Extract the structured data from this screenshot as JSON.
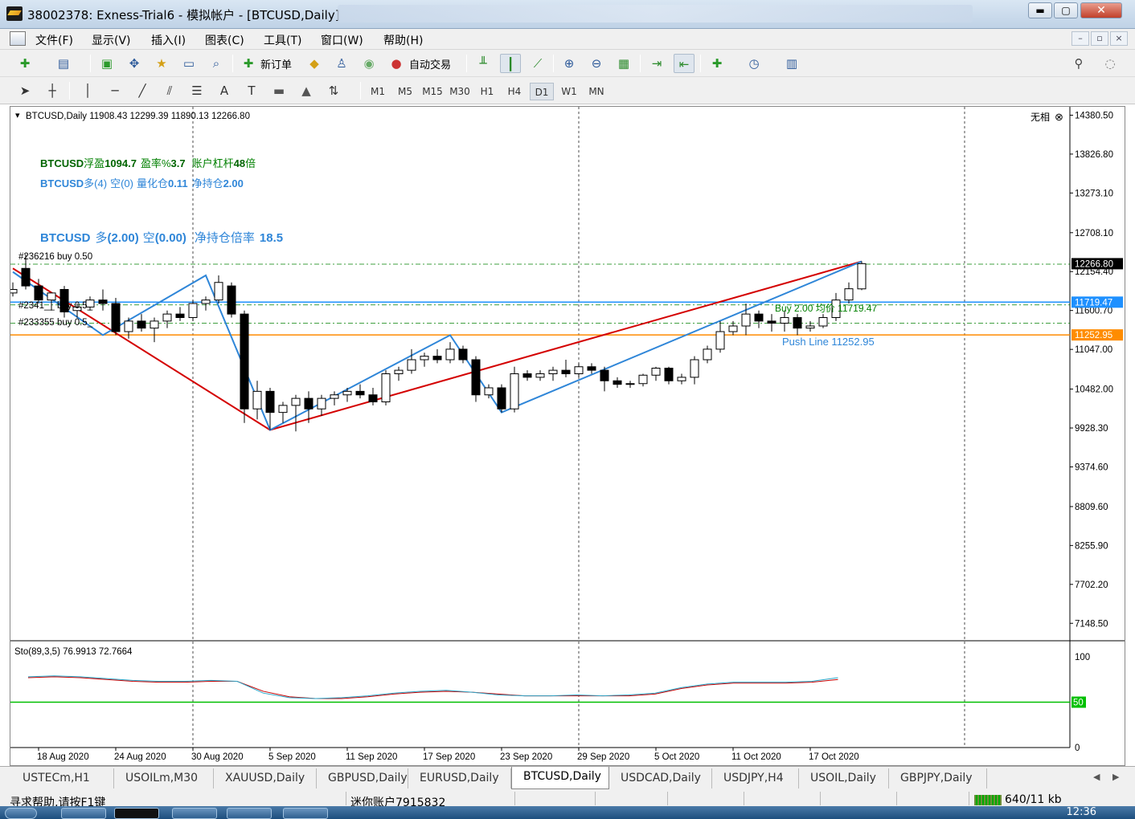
{
  "window": {
    "title": "38002378: Exness-Trial6 - 模拟帐户 - [BTCUSD,Daily]",
    "close_glyph": "✕",
    "min_glyph": "▬",
    "max_glyph": "▢"
  },
  "menu": [
    "文件(F)",
    "显示(V)",
    "插入(I)",
    "图表(C)",
    "工具(T)",
    "窗口(W)",
    "帮助(H)"
  ],
  "toolbar": {
    "new_order": "新订单",
    "auto_trading": "自动交易"
  },
  "drawing_tools": {
    "text": "A",
    "label_tool": "T"
  },
  "timeframes": [
    "M1",
    "M5",
    "M15",
    "M30",
    "H1",
    "H4",
    "D1",
    "W1",
    "MN"
  ],
  "active_timeframe": "D1",
  "chart": {
    "header": "BTCUSD,Daily  11908.43 12299.39 11890.13 12266.80",
    "shift_label": "无相",
    "info1": {
      "symbol": "BTCUSD",
      "float_label": "浮盈",
      "float": "1094.7",
      "rate_label": "盈率%",
      "rate": "3.7",
      "lev_label": "账户杠杆",
      "lev": "48",
      "lev_suffix": "倍"
    },
    "info2": {
      "symbol": "BTCUSD",
      "long": "多(4)",
      "short": "空(0)",
      "qty_label": "量化仓",
      "qty": "0.11",
      "net_label": "净持仓",
      "net": "2.00"
    },
    "info3": {
      "symbol": "BTCUSD",
      "long_label": "多",
      "long": "(2.00)",
      "short_label": "空",
      "short": "(0.00)",
      "ratio_label": "净持仓倍率",
      "ratio": "18.5"
    },
    "order_labels": [
      "#236216 buy 0.50",
      "#2341__ buy 0.5_",
      "#233355 buy 0.5_"
    ],
    "buy_avg_label": "Buy 2.00 均价 11719.47",
    "push_line_label": "Push Line  11252.95",
    "price_axis": [
      "14380.50",
      "13826.80",
      "13273.10",
      "12708.10",
      "12154.40",
      "11600.70",
      "11047.00",
      "10482.00",
      "9928.30",
      "9374.60",
      "8809.60",
      "8255.90",
      "7702.20",
      "7148.50"
    ],
    "price_tags": {
      "current": "12266.80",
      "avg": "11719.47",
      "push": "11252.95"
    },
    "date_axis": [
      "18 Aug 2020",
      "24 Aug 2020",
      "30 Aug 2020",
      "5 Sep 2020",
      "11 Sep 2020",
      "17 Sep 2020",
      "23 Sep 2020",
      "29 Sep 2020",
      "5 Oct 2020",
      "11 Oct 2020",
      "17 Oct 2020"
    ],
    "stoch_label": "Sto(89,3,5) 76.9913 72.7664",
    "stoch_axis": [
      "100",
      "50",
      "0"
    ],
    "stoch_level_tag": "50",
    "colors": {
      "buy_line": "#008000",
      "avg_line": "#1e90ff",
      "push_line": "#ff8c00",
      "zz_red": "#d40000",
      "zz_blue": "#2f86d8",
      "sto_main": "#2aa7c9",
      "sto_signal": "#c80000",
      "level50": "#00c000"
    }
  },
  "chart_data": {
    "type": "candlestick",
    "symbol": "BTCUSD",
    "timeframe": "Daily",
    "candles": [
      {
        "date": "2020-08-16",
        "o": 11850,
        "h": 12000,
        "l": 11800,
        "c": 11900
      },
      {
        "date": "2020-08-17",
        "o": 12200,
        "h": 12400,
        "l": 11900,
        "c": 11950
      },
      {
        "date": "2020-08-18",
        "o": 11950,
        "h": 12050,
        "l": 11700,
        "c": 11750
      },
      {
        "date": "2020-08-19",
        "o": 11750,
        "h": 11850,
        "l": 11600,
        "c": 11850
      },
      {
        "date": "2020-08-20",
        "o": 11900,
        "h": 11950,
        "l": 11500,
        "c": 11580
      },
      {
        "date": "2020-08-21",
        "o": 11600,
        "h": 11700,
        "l": 11500,
        "c": 11650
      },
      {
        "date": "2020-08-22",
        "o": 11650,
        "h": 11800,
        "l": 11600,
        "c": 11750
      },
      {
        "date": "2020-08-23",
        "o": 11750,
        "h": 11900,
        "l": 11600,
        "c": 11700
      },
      {
        "date": "2020-08-24",
        "o": 11700,
        "h": 11780,
        "l": 11250,
        "c": 11300
      },
      {
        "date": "2020-08-25",
        "o": 11300,
        "h": 11500,
        "l": 11200,
        "c": 11450
      },
      {
        "date": "2020-08-26",
        "o": 11450,
        "h": 11550,
        "l": 11300,
        "c": 11350
      },
      {
        "date": "2020-08-27",
        "o": 11350,
        "h": 11500,
        "l": 11150,
        "c": 11450
      },
      {
        "date": "2020-08-28",
        "o": 11450,
        "h": 11600,
        "l": 11350,
        "c": 11550
      },
      {
        "date": "2020-08-29",
        "o": 11550,
        "h": 11650,
        "l": 11450,
        "c": 11500
      },
      {
        "date": "2020-08-30",
        "o": 11500,
        "h": 11750,
        "l": 11450,
        "c": 11700
      },
      {
        "date": "2020-08-31",
        "o": 11700,
        "h": 11800,
        "l": 11600,
        "c": 11750
      },
      {
        "date": "2020-09-01",
        "o": 11750,
        "h": 12100,
        "l": 11700,
        "c": 12000
      },
      {
        "date": "2020-09-02",
        "o": 11950,
        "h": 12000,
        "l": 11500,
        "c": 11550
      },
      {
        "date": "2020-09-03",
        "o": 11550,
        "h": 11600,
        "l": 10000,
        "c": 10200
      },
      {
        "date": "2020-09-04",
        "o": 10200,
        "h": 10600,
        "l": 10050,
        "c": 10450
      },
      {
        "date": "2020-09-05",
        "o": 10450,
        "h": 10500,
        "l": 9900,
        "c": 10150
      },
      {
        "date": "2020-09-06",
        "o": 10150,
        "h": 10300,
        "l": 10000,
        "c": 10250
      },
      {
        "date": "2020-09-07",
        "o": 10250,
        "h": 10400,
        "l": 9880,
        "c": 10350
      },
      {
        "date": "2020-09-08",
        "o": 10350,
        "h": 10450,
        "l": 10000,
        "c": 10200
      },
      {
        "date": "2020-09-09",
        "o": 10200,
        "h": 10400,
        "l": 10100,
        "c": 10350
      },
      {
        "date": "2020-09-10",
        "o": 10350,
        "h": 10450,
        "l": 10250,
        "c": 10400
      },
      {
        "date": "2020-09-11",
        "o": 10400,
        "h": 10500,
        "l": 10300,
        "c": 10450
      },
      {
        "date": "2020-09-12",
        "o": 10450,
        "h": 10550,
        "l": 10350,
        "c": 10400
      },
      {
        "date": "2020-09-13",
        "o": 10400,
        "h": 10500,
        "l": 10250,
        "c": 10300
      },
      {
        "date": "2020-09-14",
        "o": 10300,
        "h": 10750,
        "l": 10250,
        "c": 10700
      },
      {
        "date": "2020-09-15",
        "o": 10700,
        "h": 10800,
        "l": 10600,
        "c": 10750
      },
      {
        "date": "2020-09-16",
        "o": 10750,
        "h": 11050,
        "l": 10700,
        "c": 10900
      },
      {
        "date": "2020-09-17",
        "o": 10900,
        "h": 11000,
        "l": 10800,
        "c": 10950
      },
      {
        "date": "2020-09-18",
        "o": 10950,
        "h": 11050,
        "l": 10850,
        "c": 10900
      },
      {
        "date": "2020-09-19",
        "o": 10900,
        "h": 11150,
        "l": 10850,
        "c": 11050
      },
      {
        "date": "2020-09-20",
        "o": 11050,
        "h": 11100,
        "l": 10850,
        "c": 10900
      },
      {
        "date": "2020-09-21",
        "o": 10900,
        "h": 10950,
        "l": 10300,
        "c": 10400
      },
      {
        "date": "2020-09-22",
        "o": 10400,
        "h": 10550,
        "l": 10350,
        "c": 10500
      },
      {
        "date": "2020-09-23",
        "o": 10500,
        "h": 10550,
        "l": 10150,
        "c": 10200
      },
      {
        "date": "2020-09-24",
        "o": 10200,
        "h": 10800,
        "l": 10150,
        "c": 10700
      },
      {
        "date": "2020-09-25",
        "o": 10700,
        "h": 10750,
        "l": 10600,
        "c": 10650
      },
      {
        "date": "2020-09-26",
        "o": 10650,
        "h": 10750,
        "l": 10600,
        "c": 10700
      },
      {
        "date": "2020-09-27",
        "o": 10700,
        "h": 10800,
        "l": 10600,
        "c": 10750
      },
      {
        "date": "2020-09-28",
        "o": 10750,
        "h": 10900,
        "l": 10650,
        "c": 10700
      },
      {
        "date": "2020-09-29",
        "o": 10700,
        "h": 10850,
        "l": 10650,
        "c": 10800
      },
      {
        "date": "2020-09-30",
        "o": 10800,
        "h": 10850,
        "l": 10700,
        "c": 10750
      },
      {
        "date": "2020-10-01",
        "o": 10750,
        "h": 10800,
        "l": 10450,
        "c": 10600
      },
      {
        "date": "2020-10-02",
        "o": 10600,
        "h": 10650,
        "l": 10500,
        "c": 10550
      },
      {
        "date": "2020-10-03",
        "o": 10550,
        "h": 10600,
        "l": 10500,
        "c": 10560
      },
      {
        "date": "2020-10-04",
        "o": 10560,
        "h": 10700,
        "l": 10520,
        "c": 10680
      },
      {
        "date": "2020-10-05",
        "o": 10680,
        "h": 10800,
        "l": 10600,
        "c": 10780
      },
      {
        "date": "2020-10-06",
        "o": 10780,
        "h": 10800,
        "l": 10550,
        "c": 10600
      },
      {
        "date": "2020-10-07",
        "o": 10600,
        "h": 10700,
        "l": 10550,
        "c": 10650
      },
      {
        "date": "2020-10-08",
        "o": 10650,
        "h": 10950,
        "l": 10550,
        "c": 10900
      },
      {
        "date": "2020-10-09",
        "o": 10900,
        "h": 11100,
        "l": 10850,
        "c": 11050
      },
      {
        "date": "2020-10-10",
        "o": 11050,
        "h": 11450,
        "l": 11000,
        "c": 11300
      },
      {
        "date": "2020-10-11",
        "o": 11300,
        "h": 11450,
        "l": 11250,
        "c": 11380
      },
      {
        "date": "2020-10-12",
        "o": 11380,
        "h": 11700,
        "l": 11250,
        "c": 11550
      },
      {
        "date": "2020-10-13",
        "o": 11550,
        "h": 11600,
        "l": 11350,
        "c": 11450
      },
      {
        "date": "2020-10-14",
        "o": 11450,
        "h": 11550,
        "l": 11300,
        "c": 11420
      },
      {
        "date": "2020-10-15",
        "o": 11420,
        "h": 11600,
        "l": 11300,
        "c": 11500
      },
      {
        "date": "2020-10-16",
        "o": 11500,
        "h": 11550,
        "l": 11250,
        "c": 11350
      },
      {
        "date": "2020-10-17",
        "o": 11350,
        "h": 11450,
        "l": 11300,
        "c": 11380
      },
      {
        "date": "2020-10-18",
        "o": 11380,
        "h": 11550,
        "l": 11350,
        "c": 11500
      },
      {
        "date": "2020-10-19",
        "o": 11500,
        "h": 11850,
        "l": 11450,
        "c": 11750
      },
      {
        "date": "2020-10-20",
        "o": 11750,
        "h": 12000,
        "l": 11700,
        "c": 11910
      },
      {
        "date": "2020-10-21",
        "o": 11908.43,
        "h": 12299.39,
        "l": 11890.13,
        "c": 12266.8
      }
    ],
    "horizontal_lines": [
      {
        "name": "order #236216 buy 0.50",
        "price": 12260
      },
      {
        "name": "order #2341__ buy 0.5_",
        "price": 11680
      },
      {
        "name": "order #233355 buy 0.5_",
        "price": 11420
      },
      {
        "name": "Buy 2.00 均价",
        "price": 11719.47
      },
      {
        "name": "Push Line",
        "price": 11252.95
      }
    ],
    "zigzag_red": [
      [
        "2020-08-16",
        12200
      ],
      [
        "2020-09-05",
        9900
      ],
      [
        "2020-10-21",
        12299
      ]
    ],
    "zigzag_blue": [
      [
        "2020-08-16",
        12150
      ],
      [
        "2020-08-23",
        11250
      ],
      [
        "2020-08-31",
        12100
      ],
      [
        "2020-09-05",
        9900
      ],
      [
        "2020-09-19",
        11250
      ],
      [
        "2020-09-23",
        10150
      ],
      [
        "2020-10-21",
        12299
      ]
    ],
    "stochastic": {
      "main": [
        78,
        79,
        78,
        76,
        74,
        73,
        73,
        74,
        73,
        60,
        55,
        54,
        55,
        57,
        60,
        62,
        63,
        61,
        58,
        57,
        57,
        58,
        57,
        58,
        60,
        66,
        70,
        72,
        72,
        72,
        73,
        77
      ],
      "signal": [
        77,
        78,
        77,
        75,
        73,
        72,
        72,
        73,
        73,
        62,
        56,
        54,
        54,
        56,
        59,
        61,
        62,
        61,
        59,
        57,
        57,
        57,
        57,
        57,
        59,
        65,
        69,
        71,
        71,
        71,
        72,
        75
      ],
      "levels": [
        50
      ]
    },
    "y_range": [
      6900,
      14500
    ],
    "x_range": [
      "2020-08-16",
      "2020-10-21"
    ]
  },
  "tabs": [
    "USTECm,H1",
    "USOILm,M30",
    "XAUUSD,Daily",
    "GBPUSD,Daily",
    "EURUSD,Daily",
    "BTCUSD,Daily",
    "USDCAD,Daily",
    "USDJPY,H4",
    "USOIL,Daily",
    "GBPJPY,Daily"
  ],
  "active_tab": "BTCUSD,Daily",
  "tab_arrows": {
    "left": "◀",
    "right": "▶"
  },
  "status": {
    "help": "寻求帮助,请按F1键",
    "account": "迷你账户7915832",
    "traffic": "640/11 kb"
  },
  "taskbar": {
    "clock": "12:36"
  }
}
